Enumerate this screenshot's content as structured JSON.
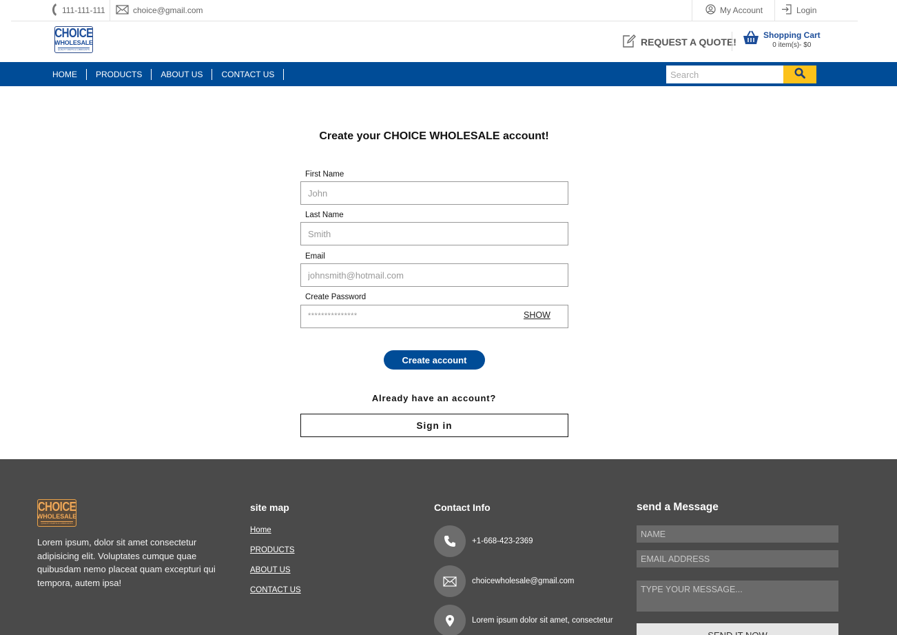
{
  "topbar": {
    "phone": "111-111-111",
    "email": "choice@gmail.com",
    "account": "My Account",
    "login": "Login"
  },
  "header": {
    "logo_line1": "CHOICE",
    "logo_line2": "WHOLESALE",
    "logo_tagline": "QUALITY PARTS & LUBRICANTS",
    "quote": "REQUEST A QUOTE!",
    "cart_title": "Shopping Cart",
    "cart_summary": "0 item(s)- $0"
  },
  "nav": {
    "items": [
      "HOME",
      "PRODUCTS",
      "ABOUT US",
      "CONTACT US"
    ],
    "search_placeholder": "Search"
  },
  "form": {
    "title": "Create your CHOICE WHOLESALE account!",
    "first_name_label": "First Name",
    "first_name_placeholder": "John",
    "last_name_label": "Last Name",
    "last_name_placeholder": "Smith",
    "email_label": "Email",
    "email_placeholder": "johnsmith@hotmail.com",
    "password_label": "Create Password",
    "password_mask": "***************",
    "show_label": "SHOW",
    "create_button": "Create account",
    "already": "Already have an account?",
    "signin_button": "Sign in"
  },
  "footer": {
    "about": "Lorem ipsum, dolor sit amet consectetur adipisicing elit. Voluptates cumque quae quibusdam nemo placeat quam excepturi qui tempora, autem ipsa!",
    "sitemap_title": "site map",
    "sitemap_links": [
      "Home",
      "PRODUCTS",
      "ABOUT US",
      "CONTACT US"
    ],
    "contact_title": "Contact Info",
    "contact_phone": "+1-668-423-2369",
    "contact_email": "choicewholesale@gmail.com",
    "contact_address": "Lorem ipsum dolor sit amet, consectetur",
    "message_title": "send a Message",
    "name_placeholder": "NAME",
    "email_placeholder": "EMAIL ADDRESS",
    "message_placeholder": "TYPE YOUR MESSAGE...",
    "send_button": "SEND IT NOW"
  },
  "colors": {
    "brand_blue": "#004c97",
    "search_yellow": "#fcc21b",
    "footer_bg": "#4a4a4a"
  },
  "icons": [
    "phone-icon",
    "mail-icon",
    "user-circle-icon",
    "login-icon",
    "edit-icon",
    "basket-icon",
    "search-icon",
    "location-icon"
  ]
}
